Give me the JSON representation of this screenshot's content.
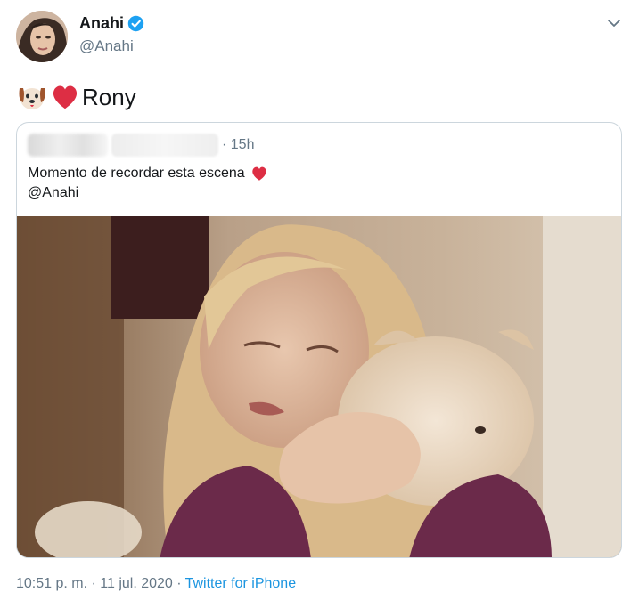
{
  "author": {
    "display_name": "Anahi",
    "handle": "@Anahi"
  },
  "tweet": {
    "text": "Rony",
    "emoji": [
      "dog-face-emoji",
      "red-heart-emoji"
    ]
  },
  "quoted_tweet": {
    "time": "15h",
    "separator": "·",
    "text_line1": "Momento de recordar esta escena",
    "text_line2": "@Anahi"
  },
  "footer": {
    "datetime": "10:51 p. m. · 11 jul. 2020 ·",
    "source": "Twitter for iPhone"
  },
  "colors": {
    "link": "#1b95e0",
    "verified": "#1da1f2",
    "secondary_text": "#657786",
    "heart": "#e0245e",
    "border": "#ccd6dd"
  }
}
